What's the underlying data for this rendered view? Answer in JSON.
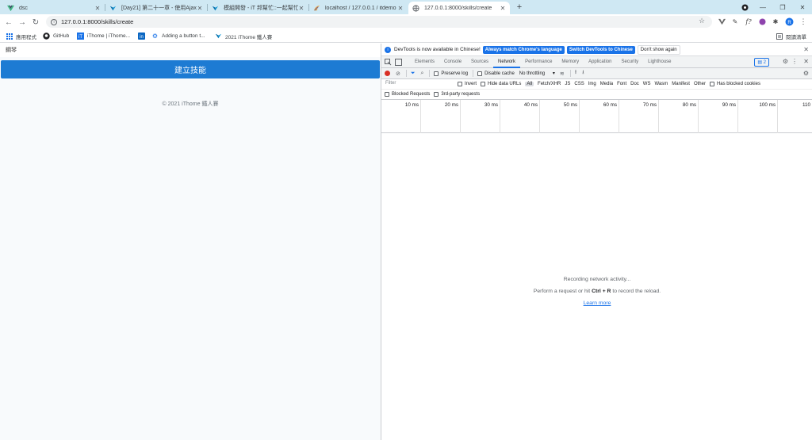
{
  "colors": {
    "tabstrip": "#cfe8f3",
    "primary_button": "#1d7bd3",
    "devtools_accent": "#1a73e8",
    "record": "#d93025"
  },
  "tabs": [
    {
      "title": "dsc",
      "icon": "vue-icon"
    },
    {
      "title": "[Day21] 第二十一章 - 使用Ajax傳",
      "icon": "ithome-icon"
    },
    {
      "title": "模組開發 - iT 邦幫忙::一起幫忙解",
      "icon": "ithome-icon"
    },
    {
      "title": "localhost / 127.0.0.1 / itdemo /",
      "icon": "phpmyadmin-icon"
    },
    {
      "title": "127.0.0.1:8000/skills/create",
      "icon": "globe-icon",
      "active": true
    }
  ],
  "toolbar": {
    "url": "127.0.0.1:8000/skills/create"
  },
  "bookmarks": {
    "items": [
      {
        "label": "應用程式",
        "icon": "apps-icon"
      },
      {
        "label": "GitHub",
        "icon": "github-icon"
      },
      {
        "label": "iThome | iThome...",
        "icon": "ithome-icon"
      },
      {
        "label": "",
        "icon": "linkedin-icon"
      },
      {
        "label": "Adding a button t...",
        "icon": "gear-icon"
      },
      {
        "label": "2021 iThome 鐵人賽",
        "icon": "ithome-icon"
      }
    ],
    "reading_list": "閱讀清單"
  },
  "page": {
    "navbar_text": "鋼琴",
    "create_button": "建立技能",
    "footer": "© 2021 iThome 鐵人賽"
  },
  "devtools": {
    "info_text": "DevTools is now available in Chinese!",
    "info_btn_match": "Always match Chrome's language",
    "info_btn_switch": "Switch DevTools to Chinese",
    "info_btn_dismiss": "Don't show again",
    "tabs": [
      "Elements",
      "Console",
      "Sources",
      "Network",
      "Performance",
      "Memory",
      "Application",
      "Security",
      "Lighthouse"
    ],
    "selected_tab": "Network",
    "issues_count": "2",
    "preserve_log": "Preserve log",
    "disable_cache": "Disable cache",
    "throttling": "No throttling",
    "filter_placeholder": "Filter",
    "invert": "Invert",
    "hide_data_urls": "Hide data URLs",
    "filter_types": [
      "All",
      "Fetch/XHR",
      "JS",
      "CSS",
      "Img",
      "Media",
      "Font",
      "Doc",
      "WS",
      "Wasm",
      "Manifest",
      "Other"
    ],
    "has_blocked_cookies": "Has blocked cookies",
    "blocked_requests": "Blocked Requests",
    "third_party": "3rd-party requests",
    "timeline_ticks": [
      "10 ms",
      "20 ms",
      "30 ms",
      "40 ms",
      "50 ms",
      "60 ms",
      "70 ms",
      "80 ms",
      "90 ms",
      "100 ms",
      "110"
    ],
    "empty_line1": "Recording network activity...",
    "empty_line2_pre": "Perform a request or hit",
    "empty_line2_key": "Ctrl + R",
    "empty_line2_post": "to record the reload.",
    "learn_more": "Learn more"
  }
}
